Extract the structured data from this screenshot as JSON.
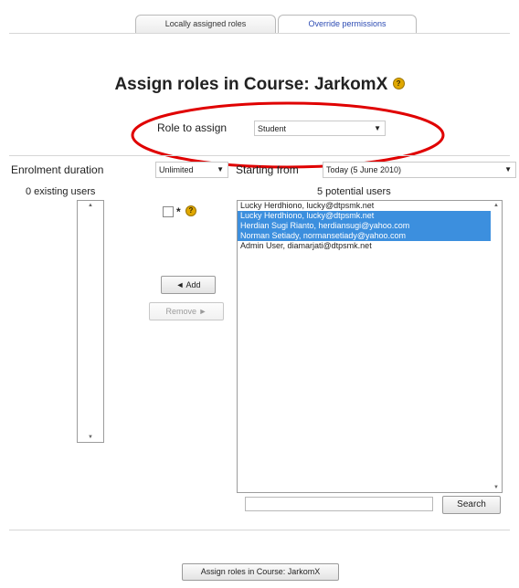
{
  "tabs": [
    {
      "label": "Locally assigned roles"
    },
    {
      "label": "Override permissions"
    }
  ],
  "page_title": "Assign roles in Course: JarkomX",
  "help_icon_glyph": "?",
  "role_label": "Role to assign",
  "role_value": "Student",
  "enrolment": {
    "duration_label": "Enrolment duration",
    "duration_value": "Unlimited",
    "starting_label": "Starting from",
    "starting_value": "Today (5 June 2010)"
  },
  "existing_users": {
    "heading": "0 existing users"
  },
  "potential_users": {
    "heading": "5 potential users",
    "items": [
      {
        "text": "Lucky Herdhiono, lucky@dtpsmk.net",
        "selected": false
      },
      {
        "text": "Lucky Herdhiono, lucky@dtpsmk.net",
        "selected": true
      },
      {
        "text": "Herdian Sugi Rianto, herdiansugi@yahoo.com",
        "selected": true
      },
      {
        "text": "Norman Setiady, normansetiady@yahoo.com",
        "selected": true
      },
      {
        "text": "Admin User, diamarjati@dtpsmk.net",
        "selected": false
      }
    ]
  },
  "hidden_marker": "*",
  "add_button": "◄ Add",
  "remove_button": "Remove ►",
  "search_button": "Search",
  "search_value": "",
  "submit_button": "Assign roles in Course: JarkomX",
  "annotation_color": "#e00000",
  "selection_color": "#3c8fde"
}
